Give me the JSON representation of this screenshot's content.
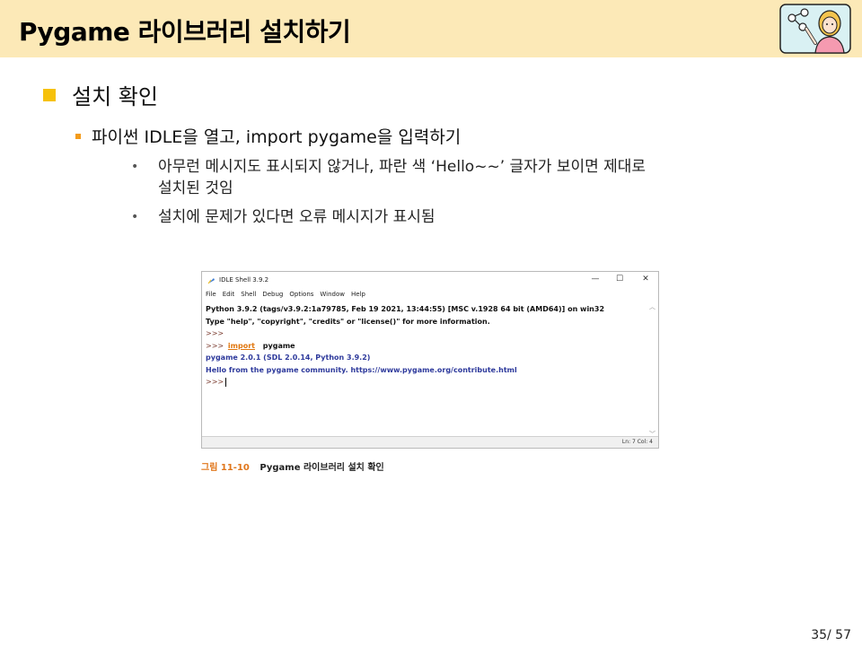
{
  "slide": {
    "title": "Pygame 라이브러리 설치하기",
    "heading1": "설치 확인",
    "heading2": "파이썬 IDLE을 열고, import pygame을 입력하기",
    "bullets": [
      {
        "line1": "아무런 메시지도 표시되지 않거나, 파란 색 ‘Hello~~’ 글자가 보이면 제대로",
        "line2": "설치된 것임"
      },
      {
        "line1": "설치에 문제가 있다면 오류 메시지가 표시됨"
      }
    ],
    "page": "35/ 57"
  },
  "idle": {
    "title": "IDLE Shell 3.9.2",
    "menu": [
      "File",
      "Edit",
      "Shell",
      "Debug",
      "Options",
      "Window",
      "Help"
    ],
    "lines": {
      "l1": "Python 3.9.2 (tags/v3.9.2:1a79785, Feb 19 2021, 13:44:55) [MSC v.1928 64 bit (AMD64)] on win32",
      "l2": "Type \"help\", \"copyright\", \"credits\" or \"license()\" for more information.",
      "prompt": ">>>",
      "import_kw": "import",
      "import_mod": "pygame",
      "l5": "pygame 2.0.1 (SDL 2.0.14, Python 3.9.2)",
      "l6": "Hello from the pygame community. https://www.pygame.org/contribute.html"
    },
    "status": "Ln: 7   Col: 4"
  },
  "caption": {
    "number": "그림 11-10",
    "text": "Pygame 라이브러리 설치 확인"
  },
  "colors": {
    "header_bg": "#fce9b7",
    "bullet_yellow": "#f6c10b",
    "bullet_orange": "#f39b1b",
    "idle_blue": "#2e3a9c",
    "keyword_orange": "#e0760d"
  }
}
